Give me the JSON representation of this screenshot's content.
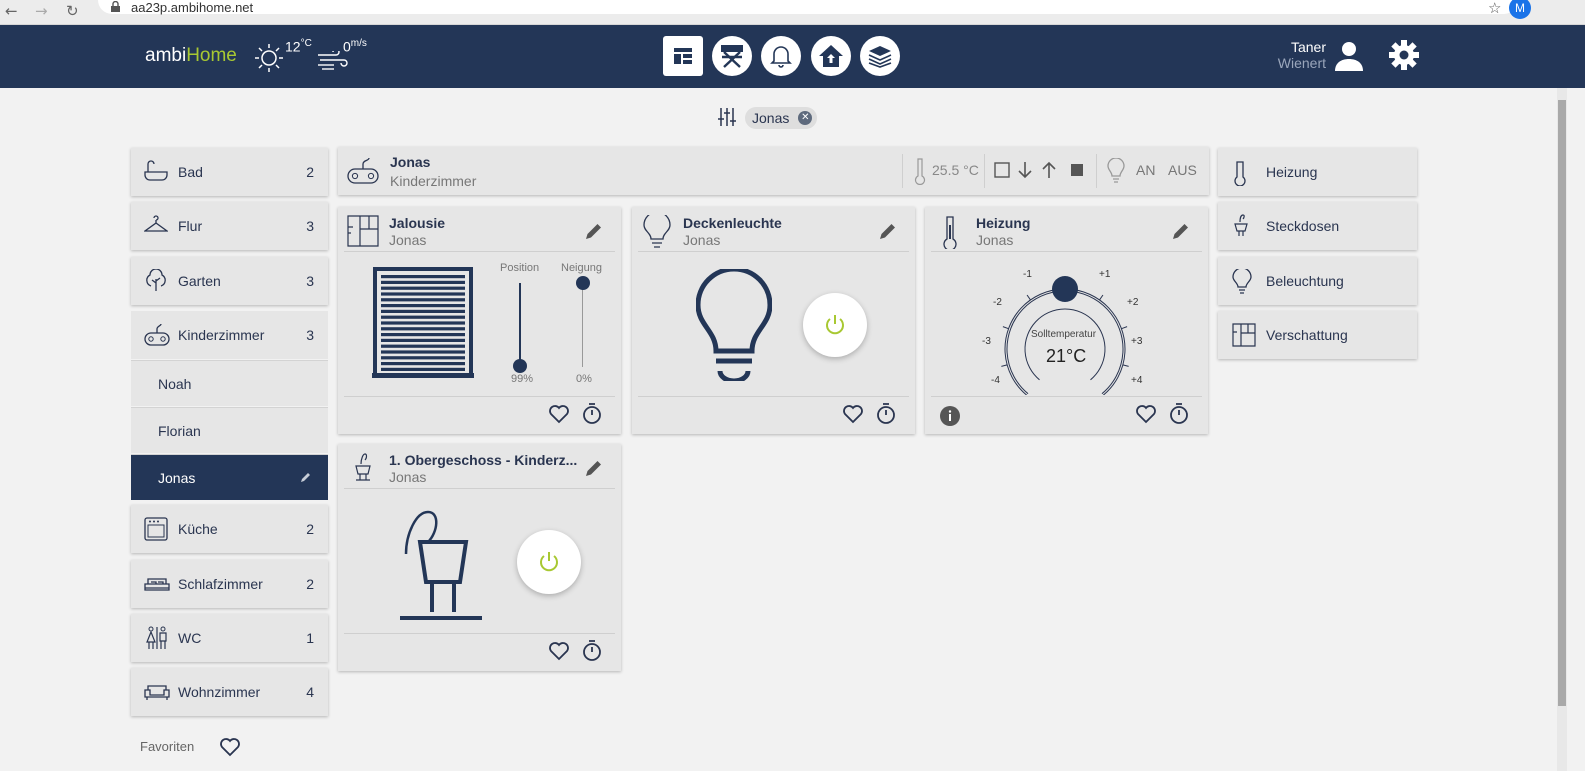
{
  "browser": {
    "url": "aa23p.ambihome.net",
    "profile_initial": "M"
  },
  "header": {
    "logo_a": "ambi",
    "logo_b": "Home",
    "temperature": "12",
    "temperature_unit": "°C",
    "wind": "0",
    "wind_unit": "m/s",
    "nav_icons": [
      "dashboard-icon",
      "director-chair-icon",
      "bell-icon",
      "house-icon",
      "layers-icon"
    ],
    "user_first": "Taner",
    "user_last": "Wienert"
  },
  "filter": {
    "chip": "Jonas",
    "chip_close": "✕"
  },
  "sidebar": {
    "rooms": [
      {
        "label": "Bad",
        "count": "2"
      },
      {
        "label": "Flur",
        "count": "3"
      },
      {
        "label": "Garten",
        "count": "3"
      },
      {
        "label": "Kinderzimmer",
        "count": "3"
      },
      {
        "label": "Küche",
        "count": "2"
      },
      {
        "label": "Schlafzimmer",
        "count": "2"
      },
      {
        "label": "WC",
        "count": "1"
      },
      {
        "label": "Wohnzimmer",
        "count": "4"
      }
    ],
    "subrooms": [
      "Noah",
      "Florian",
      "Jonas"
    ],
    "favorites": "Favoriten"
  },
  "roombar": {
    "title": "Jonas",
    "subtitle": "Kinderzimmer",
    "temperature": "25.5 °C",
    "on": "AN",
    "off": "AUS"
  },
  "cards": {
    "jalousie": {
      "title": "Jalousie",
      "room": "Jonas",
      "pos_label": "Position",
      "tilt_label": "Neigung",
      "pos_value": "99%",
      "tilt_value": "0%",
      "position": 0.99,
      "tilt": 0.0
    },
    "licht": {
      "title": "Deckenleuchte",
      "room": "Jonas"
    },
    "heizung": {
      "title": "Heizung",
      "room": "Jonas",
      "set_label": "Solltemperatur",
      "set_value": "21°C",
      "ticks": [
        "-4",
        "-3",
        "-2",
        "-1",
        "+1",
        "+2",
        "+3",
        "+4"
      ]
    },
    "steckdose": {
      "title": "1. Obergeschoss - Kinderz...",
      "room": "Jonas"
    }
  },
  "right_panel": [
    "Heizung",
    "Steckdosen",
    "Beleuchtung",
    "Verschattung"
  ]
}
